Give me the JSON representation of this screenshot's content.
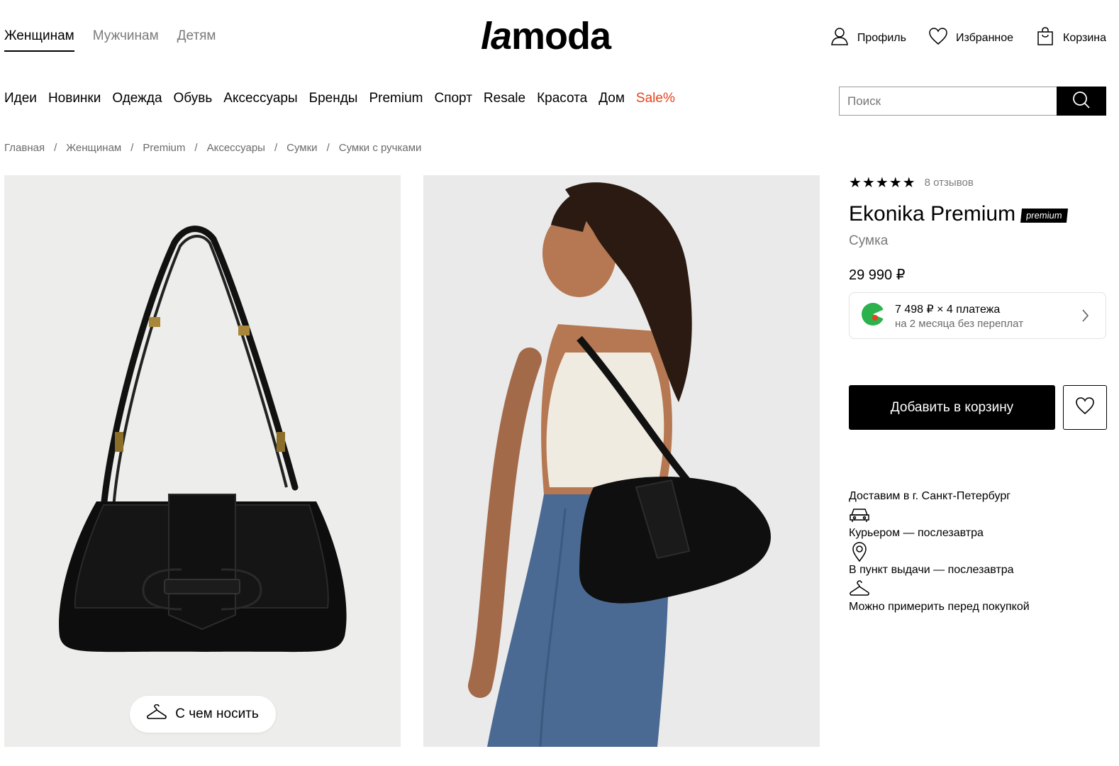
{
  "header": {
    "gender_tabs": [
      "Женщинам",
      "Мужчинам",
      "Детям"
    ],
    "logo_la": "la",
    "logo_moda": "moda",
    "actions": {
      "profile": "Профиль",
      "favorites": "Избранное",
      "cart": "Корзина"
    }
  },
  "nav": {
    "categories": [
      "Идеи",
      "Новинки",
      "Одежда",
      "Обувь",
      "Аксессуары",
      "Бренды",
      "Premium",
      "Спорт",
      "Resale",
      "Красота",
      "Дом",
      "Sale%"
    ],
    "sale_color": "#e8421a"
  },
  "search": {
    "placeholder": "Поиск"
  },
  "breadcrumb": [
    "Главная",
    "Женщинам",
    "Premium",
    "Аксессуары",
    "Сумки",
    "Сумки с ручками"
  ],
  "gallery": {
    "wear_button": "С чем носить"
  },
  "product": {
    "stars": "★★★★★",
    "rating": 5,
    "reviews": "8 отзывов",
    "brand": "Ekonika Premium",
    "badge": "premium",
    "type": "Сумка",
    "price": "29 990 ₽",
    "split": {
      "line1": "7 498 ₽ × 4 платежа",
      "line2": "на 2 месяца без переплат"
    },
    "add_to_cart": "Добавить в корзину"
  },
  "delivery": {
    "title": "Доставим в  г. Санкт-Петербург",
    "courier": "Курьером — послезавтра",
    "pickup": "В пункт выдачи — послезавтра",
    "tryon": "Можно примерить перед покупкой"
  }
}
